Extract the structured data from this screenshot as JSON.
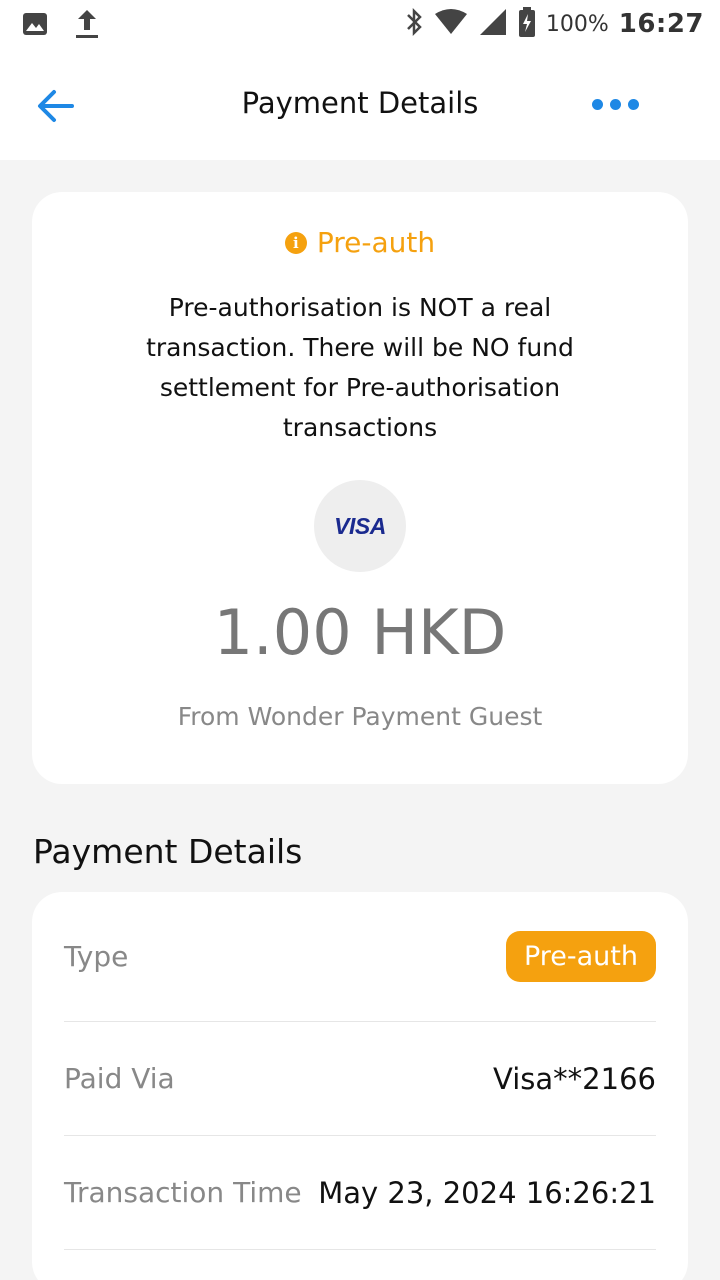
{
  "status_bar": {
    "icons": [
      "image-icon",
      "upload-icon",
      "bluetooth-icon",
      "wifi-icon",
      "signal-icon",
      "battery-icon"
    ],
    "battery": "100%",
    "time": "16:27"
  },
  "app_bar": {
    "title": "Payment Details",
    "back_icon": "arrow-left-icon",
    "more_icon": "more-dots-icon",
    "accent": "#1e88e5"
  },
  "summary": {
    "badge": "Pre-auth",
    "badge_color": "#f5a10f",
    "notice": "Pre-authorisation is NOT a real transaction. There will be NO fund settlement for Pre-authorisation transactions",
    "card_brand": "VISA",
    "amount": "1.00 HKD",
    "from_prefix": "From",
    "from_name": "Wonder Payment Guest"
  },
  "details": {
    "section_title": "Payment Details",
    "rows": [
      {
        "label": "Type",
        "value": "Pre-auth"
      },
      {
        "label": "Paid Via",
        "value": "Visa**2166"
      },
      {
        "label": "Transaction Time",
        "value": "May 23, 2024 16:26:21"
      }
    ]
  }
}
